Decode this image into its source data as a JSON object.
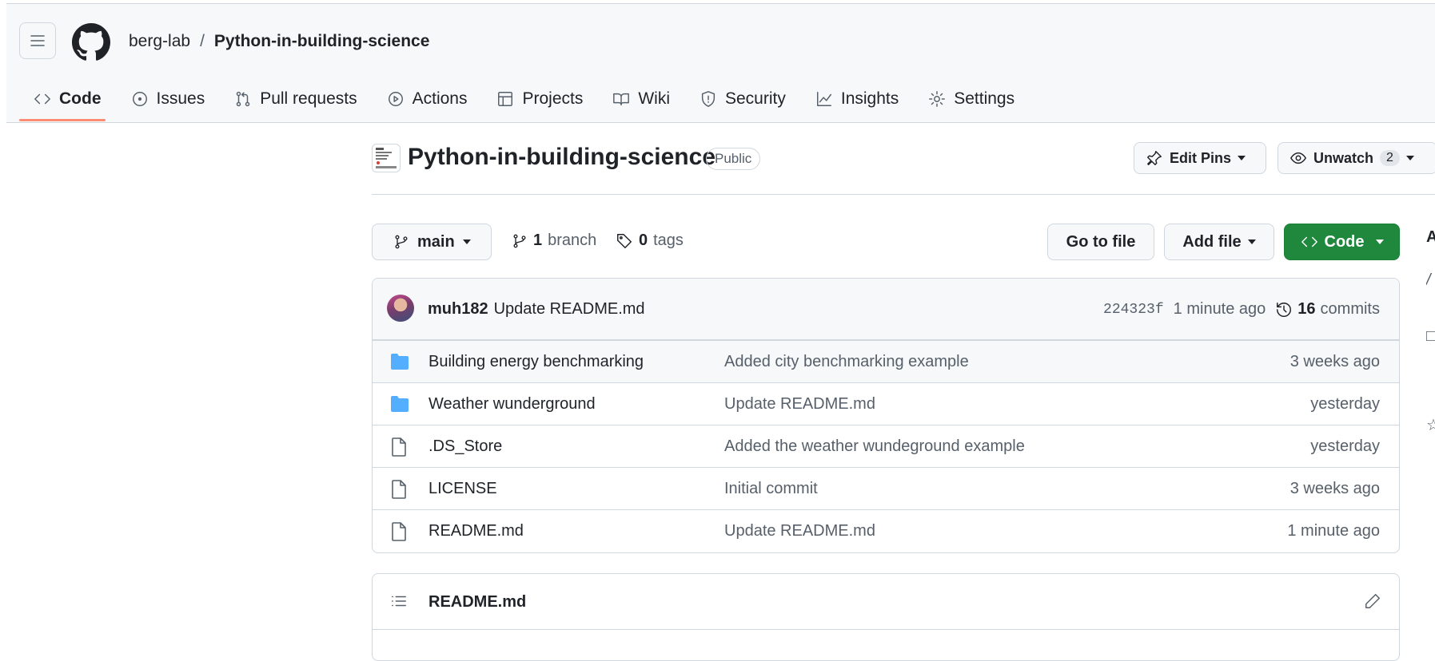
{
  "header": {
    "owner": "berg-lab",
    "separator": "/",
    "repo": "Python-in-building-science",
    "nav": [
      {
        "label": "Code",
        "icon": "code-icon",
        "selected": true
      },
      {
        "label": "Issues",
        "icon": "issue-icon"
      },
      {
        "label": "Pull requests",
        "icon": "pull-request-icon"
      },
      {
        "label": "Actions",
        "icon": "play-icon"
      },
      {
        "label": "Projects",
        "icon": "table-icon"
      },
      {
        "label": "Wiki",
        "icon": "book-icon"
      },
      {
        "label": "Security",
        "icon": "shield-icon"
      },
      {
        "label": "Insights",
        "icon": "graph-icon"
      },
      {
        "label": "Settings",
        "icon": "gear-icon"
      }
    ]
  },
  "repo": {
    "title": "Python-in-building-science",
    "visibility": "Public",
    "edit_pins": "Edit Pins",
    "unwatch": "Unwatch",
    "watch_count": "2"
  },
  "filenav": {
    "branch": "main",
    "branches_count": "1",
    "branches_label": "branch",
    "tags_count": "0",
    "tags_label": "tags",
    "go_to_file": "Go to file",
    "add_file": "Add file",
    "code": "Code"
  },
  "commit": {
    "author": "muh182",
    "message": "Update README.md",
    "sha": "224323f",
    "time": "1 minute ago",
    "count": "16",
    "count_label": "commits"
  },
  "files": [
    {
      "type": "folder",
      "name": "Building energy benchmarking",
      "message": "Added city benchmarking example",
      "age": "3 weeks ago"
    },
    {
      "type": "folder",
      "name": "Weather wunderground",
      "message": "Update README.md",
      "age": "yesterday"
    },
    {
      "type": "file",
      "name": ".DS_Store",
      "message": "Added the weather wundeground example",
      "age": "yesterday"
    },
    {
      "type": "file",
      "name": "LICENSE",
      "message": "Initial commit",
      "age": "3 weeks ago"
    },
    {
      "type": "file",
      "name": "README.md",
      "message": "Update README.md",
      "age": "1 minute ago"
    }
  ],
  "readme": {
    "title": "README.md"
  },
  "colors": {
    "accent_underline": "#fd8c73",
    "code_button": "#1f883d",
    "folder": "#54aeff"
  }
}
